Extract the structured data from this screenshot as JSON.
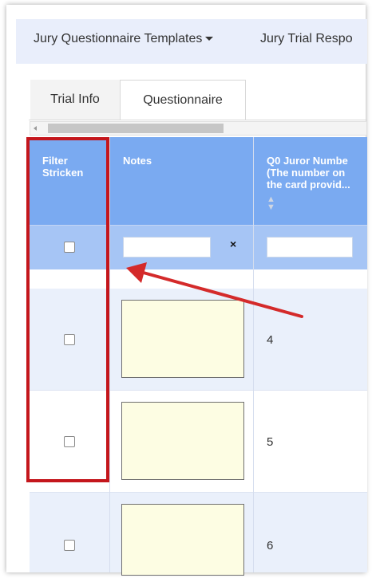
{
  "menubar": {
    "templates_label": "Jury Questionnaire Templates",
    "responses_label": "Jury Trial Respo"
  },
  "tabs": [
    {
      "label": "Trial Info",
      "active": false
    },
    {
      "label": "Questionnaire",
      "active": true
    }
  ],
  "columns": {
    "filter": {
      "header": "Filter Stricken"
    },
    "notes": {
      "header": "Notes"
    },
    "q0": {
      "header_line1": "Q0 Juror Numbe",
      "header_line2": "(The number on",
      "header_line3": "the card provid..."
    }
  },
  "filter_row": {
    "notes_clear_icon": "close-icon",
    "clear_symbol": "×"
  },
  "rows": [
    {
      "juror_number": "4"
    },
    {
      "juror_number": "5"
    },
    {
      "juror_number": "6"
    }
  ],
  "annotation": {
    "highlight_color": "#c4161c",
    "arrow_color": "#d42a2a"
  },
  "colors": {
    "header_bg": "#7aaaf1",
    "filter_row_bg": "#a6c5f5",
    "row_alt_bg": "#eaf0fb",
    "notes_bg": "#fdfde3",
    "menubar_bg": "#e9eefb"
  }
}
